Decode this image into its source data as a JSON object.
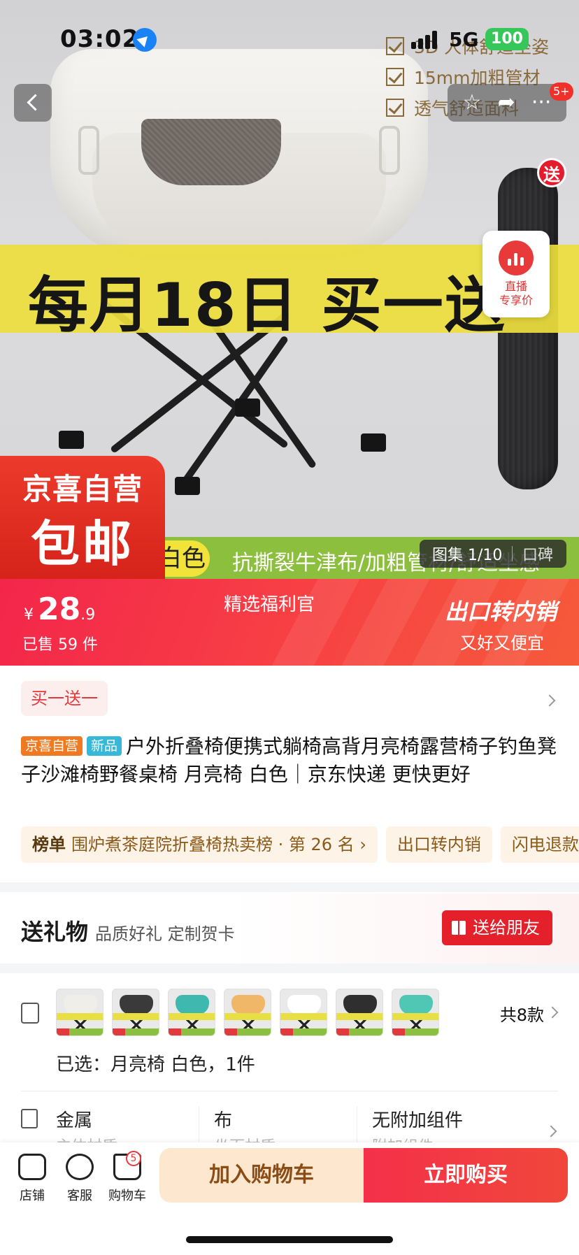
{
  "status_bar": {
    "time": "03:02",
    "network": "5G",
    "battery": "100"
  },
  "hero": {
    "features": [
      "3D 人体舒适坐姿",
      "15mm加粗管材",
      "透气舒适面料"
    ],
    "banner_text": "每月18日 买一送",
    "song_badge": "送",
    "live_card": {
      "line1": "直播",
      "line2": "专享价"
    },
    "green_strip_text": "抗撕裂牛津布/加粗管材/舒适坐感",
    "color_pill": "白色",
    "jx_badge": {
      "line1": "京喜自营",
      "line2": "包邮"
    },
    "album": {
      "label": "图集 1/10",
      "reviews": "口碑"
    },
    "notify_badge": "5+"
  },
  "price_bar": {
    "currency": "¥",
    "price_int": "28",
    "price_dec": ".9",
    "sold": "已售 59 件",
    "fuli": "精选福利官",
    "promo_title": "出口转内销",
    "promo_sub": "又好又便宜"
  },
  "info": {
    "promo_tag": "买一送一",
    "tag_jx": "京喜自营",
    "tag_new": "新品",
    "title": "户外折叠椅便携式躺椅高背月亮椅露营椅子钓鱼凳子沙滩椅野餐桌椅 月亮椅 白色｜京东快递 更快更好",
    "rank_label": "榜单",
    "rank_text": "围炉煮茶庭院折叠椅热卖榜 · 第 26 名",
    "rank_pill2": "出口转内销",
    "rank_pill3": "闪电退款"
  },
  "gift": {
    "title": "送礼物",
    "subtitle": "品质好礼 定制贺卡",
    "button": "送给朋友"
  },
  "variants": {
    "swatch_colors": [
      "#efeee9",
      "#3a3a3a",
      "#3fb9b0",
      "#f0b768",
      "#ffffff",
      "#2f2f2f",
      "#4fc7b4"
    ],
    "count_label": "共8款",
    "selected": "已选：月亮椅 白色，1件"
  },
  "specs": [
    {
      "value": "金属",
      "label": "主体材质"
    },
    {
      "value": "布",
      "label": "坐面材质"
    },
    {
      "value": "无附加组件",
      "label": "附加组件"
    }
  ],
  "bottom_bar": {
    "shop": "店铺",
    "service": "客服",
    "cart": "购物车",
    "cart_count": "5",
    "add_to_cart": "加入购物车",
    "buy_now": "立即购买"
  }
}
